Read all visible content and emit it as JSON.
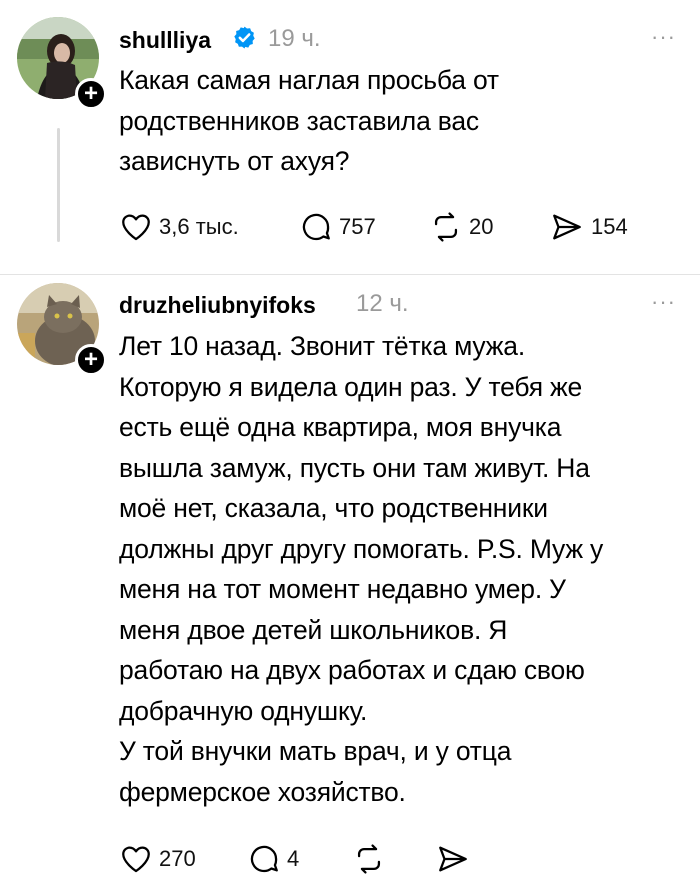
{
  "posts": [
    {
      "username": "shullliya",
      "verified": true,
      "time": "19 ч.",
      "more": "···",
      "text": "Какая самая наглая просьба от\nродственников заставила вас\nзависнуть от ахуя?",
      "likes": "3,6 тыс.",
      "comments": "757",
      "reposts": "20",
      "shares": "154",
      "icons": [
        "heart-icon",
        "comment-icon",
        "repost-icon",
        "share-icon"
      ]
    },
    {
      "username": "druzheliubnyifoks",
      "verified": false,
      "time": "12 ч.",
      "more": "···",
      "text": "Лет 10 назад. Звонит тётка мужа.\nКоторую я видела один раз. У тебя же\nесть ещё одна квартира, моя внучка\nвышла замуж, пусть они там живут. На\nмоё нет, сказала, что родственники\nдолжны друг другу помогать. P.S. Муж у\nменя на тот момент недавно умер. У\nменя двое детей школьников. Я\nработаю на двух работах и сдаю свою\nдобрачную однушку.\nУ той внучки мать врач, и у отца\nфермерское хозяйство.",
      "likes": "270",
      "comments": "4",
      "icons": [
        "heart-icon",
        "comment-icon",
        "repost-icon",
        "share-icon"
      ]
    }
  ],
  "colors": {
    "muted": "#9a9a9a",
    "verified": "#0095f6",
    "divider": "#e3e3e3"
  }
}
